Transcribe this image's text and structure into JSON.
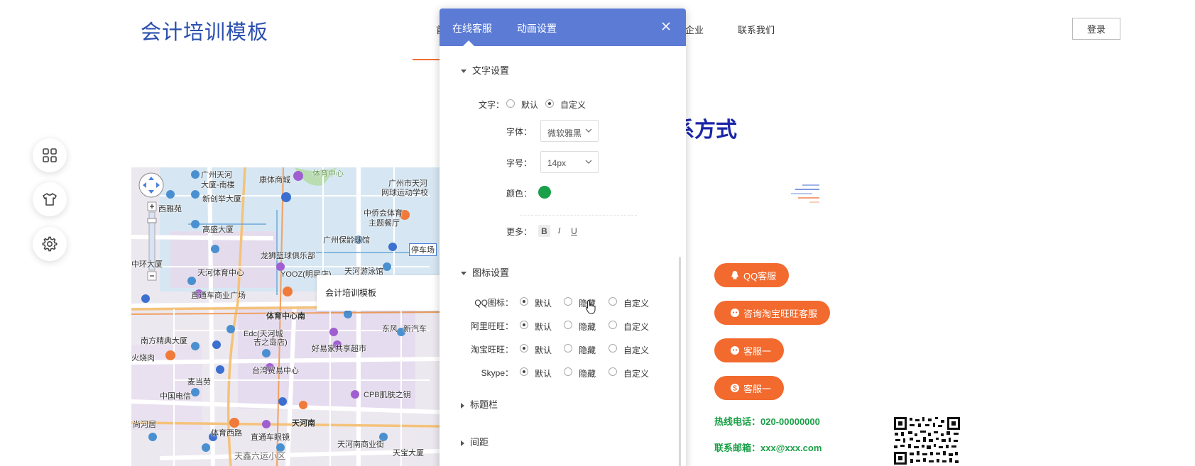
{
  "header": {
    "logo": "会计培训模板",
    "nav": [
      "首",
      "企业",
      "联系我们"
    ],
    "login": "登录",
    "accent_color": "#f07030"
  },
  "contact": {
    "title": "系方式"
  },
  "tools": [
    {
      "icon": "apps-grid-icon"
    },
    {
      "icon": "shirt-icon"
    },
    {
      "icon": "gear-icon"
    }
  ],
  "map": {
    "info_title": "会计培训模板",
    "labels": [
      "广州天河",
      "大厦-南楼",
      "康体商城",
      "体育中心",
      "广州市天河",
      "网球运动学校",
      "西雅苑",
      "新创举大厦",
      "中侨会体育",
      "主题餐厅",
      "高盛大厦",
      "广州保龄球馆",
      "龙狮篮球俱乐部",
      "停车场",
      "中环大厦",
      "天河体育中心",
      "YOOZ(明星店)",
      "天河游泳馆",
      "直通车商业广场",
      "体育中心南",
      "东风",
      "新汽车",
      "南方精典大厦",
      "Edc(天河城",
      "吉之岛店)",
      "好易家共享超市",
      "火烧肉",
      "台湾贸易中心",
      "麦当劳",
      "CPB肌肤之钥",
      "中国电信",
      "尚河居",
      "体育西路",
      "直通车眼镜",
      "天河南",
      "天河南商业街",
      "天宝大厦",
      "天鑫六运小区"
    ]
  },
  "panel": {
    "tabs": [
      "在线客服",
      "动画设置"
    ],
    "text_section": {
      "title": "文字设置",
      "text_label": "文字：",
      "text_options": [
        "默认",
        "自定义"
      ],
      "font_label": "字体：",
      "font_value": "微软雅黑",
      "size_label": "字号：",
      "size_value": "14px",
      "color_label": "颜色：",
      "color_value": "#1aa04a",
      "more_label": "更多：",
      "format": [
        "B",
        "I",
        "U"
      ]
    },
    "icon_section": {
      "title": "图标设置",
      "rows": [
        {
          "label": "QQ图标：",
          "options": [
            "默认",
            "隐藏",
            "自定义"
          ]
        },
        {
          "label": "阿里旺旺：",
          "options": [
            "默认",
            "隐藏",
            "自定义"
          ]
        },
        {
          "label": "淘宝旺旺：",
          "options": [
            "默认",
            "隐藏",
            "自定义"
          ]
        },
        {
          "label": "Skype：",
          "options": [
            "默认",
            "隐藏",
            "自定义"
          ]
        }
      ]
    },
    "title_bar": "标题栏",
    "spacing": "间距"
  },
  "service": {
    "buttons": [
      "QQ客服",
      "咨询淘宝旺旺客服",
      "客服一",
      "客服一"
    ],
    "hotline": "热线电话：020-00000000",
    "email": "联系邮箱：xxx@xxx.com",
    "button_color": "#f26a2e",
    "text_color": "#19a046"
  }
}
